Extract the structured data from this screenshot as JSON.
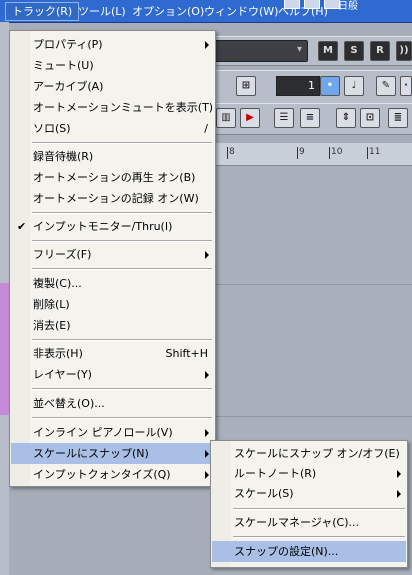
{
  "menubar": {
    "items": [
      {
        "label": "トラック(R)"
      },
      {
        "label": "ツール(L)"
      },
      {
        "label": "オプション(O)"
      },
      {
        "label": "ウィンドウ(W)"
      },
      {
        "label": "ヘルプ(H)"
      }
    ],
    "tray_text": "日般"
  },
  "toolbar": {
    "msr": [
      "M",
      "S",
      "R"
    ],
    "number_value": "1"
  },
  "ruler": {
    "ticks": [
      "8",
      "9",
      "10",
      "11"
    ]
  },
  "track_menu": {
    "items": [
      {
        "label": "プロパティ(P)",
        "submenu": true
      },
      {
        "label": "ミュート(U)"
      },
      {
        "label": "アーカイブ(A)"
      },
      {
        "label": "オートメーションミュートを表示(T)"
      },
      {
        "label": "ソロ(S)",
        "shortcut": "/"
      },
      {
        "label": "録音待機(R)"
      },
      {
        "label": "オートメーションの再生 オン(B)"
      },
      {
        "label": "オートメーションの記録 オン(W)"
      },
      {
        "label": "インプットモニター/Thru(I)",
        "checked": true
      },
      {
        "label": "フリーズ(F)",
        "submenu": true
      },
      {
        "label": "複製(C)..."
      },
      {
        "label": "削除(L)"
      },
      {
        "label": "消去(E)"
      },
      {
        "label": "非表示(H)",
        "shortcut": "Shift+H"
      },
      {
        "label": "レイヤー(Y)",
        "submenu": true
      },
      {
        "label": "並べ替え(O)..."
      },
      {
        "label": "インライン ピアノロール(V)",
        "submenu": true
      },
      {
        "label": "スケールにスナップ(N)",
        "submenu": true,
        "highlighted": true
      },
      {
        "label": "インプットクォンタイズ(Q)",
        "submenu": true
      }
    ],
    "check_mark": "✔"
  },
  "snap_submenu": {
    "items": [
      {
        "label": "スケールにスナップ オン/オフ(E)"
      },
      {
        "label": "ルートノート(R)",
        "submenu": true
      },
      {
        "label": "スケール(S)",
        "submenu": true
      },
      {
        "label": "スケールマネージャ(C)..."
      },
      {
        "label": "スナップの設定(N)...",
        "highlighted": true
      }
    ]
  }
}
